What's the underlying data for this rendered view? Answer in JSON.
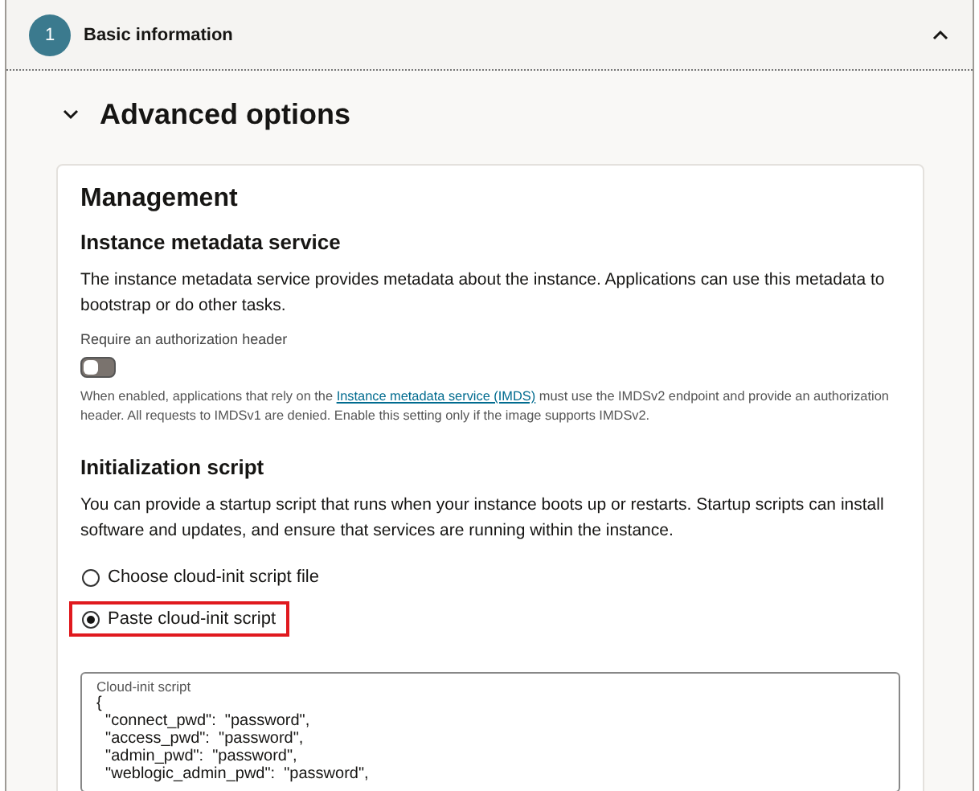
{
  "step": {
    "number": "1",
    "title": "Basic information",
    "expanded": true
  },
  "advanced": {
    "title": "Advanced options",
    "expanded": true
  },
  "management": {
    "title": "Management",
    "metadata": {
      "title": "Instance metadata service",
      "description": "The instance metadata service provides metadata about the instance. Applications can use this metadata to bootstrap or do other tasks.",
      "toggle_label": "Require an authorization header",
      "toggle_on": false,
      "help_before": "When enabled, applications that rely on the ",
      "help_link": "Instance metadata service (IMDS)",
      "help_after": " must use the IMDSv2 endpoint and provide an authorization header. All requests to IMDSv1 are denied. Enable this setting only if the image supports IMDSv2."
    },
    "init": {
      "title": "Initialization script",
      "description": "You can provide a startup script that runs when your instance boots up or restarts. Startup scripts can install software and updates, and ensure that services are running within the instance.",
      "options": [
        {
          "label": "Choose cloud-init script file",
          "selected": false,
          "highlighted": false
        },
        {
          "label": "Paste cloud-init script",
          "selected": true,
          "highlighted": true
        }
      ],
      "script_label": "Cloud-init script",
      "script_value": "{\n  \"connect_pwd\":  \"password\",\n  \"access_pwd\":  \"password\",\n  \"admin_pwd\":  \"password\",\n  \"weblogic_admin_pwd\":  \"password\","
    }
  }
}
